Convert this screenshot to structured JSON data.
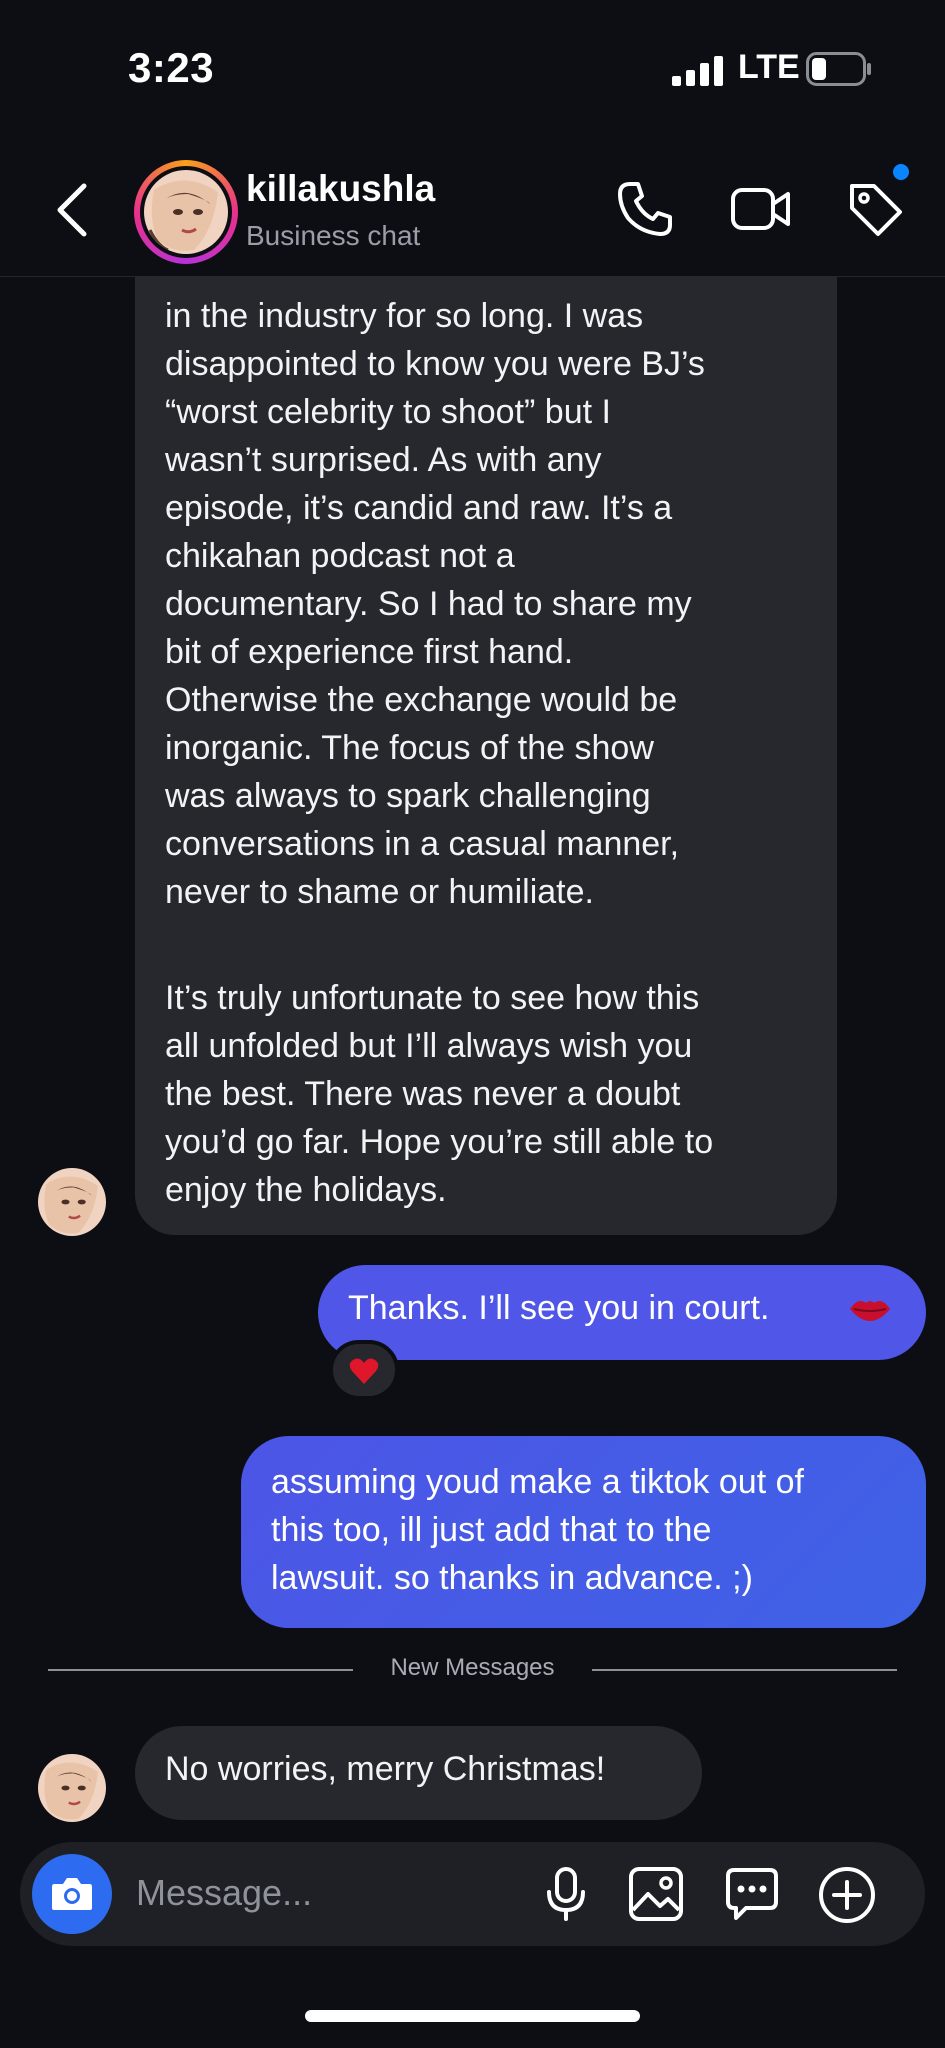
{
  "status_bar": {
    "time": "3:23",
    "network": "LTE"
  },
  "header": {
    "name": "killakushla",
    "subtitle": "Business chat"
  },
  "thread": {
    "incoming_long": [
      "in the industry for so long. I was",
      "disappointed to know you were BJ’s",
      "“worst celebrity to shoot” but I",
      "wasn’t surprised. As with any",
      "episode, it’s candid and raw. It’s a",
      "chikahan podcast not a",
      "documentary. So I had to share my",
      "bit of experience first hand.",
      "Otherwise the exchange would be",
      "inorganic. The focus of the show",
      "was always to spark challenging",
      "conversations in a casual manner,",
      "never to shame or humiliate.",
      "It’s truly unfortunate to see how this",
      "all unfolded but I’ll always wish you",
      "the best. There was never a doubt",
      "you’d go far. Hope you’re still able to",
      "enjoy the holidays."
    ],
    "outgoing_1": "Thanks. I’ll see you in court.",
    "outgoing_1_emoji": "kiss-mark-icon",
    "reaction": "heart-icon",
    "outgoing_2": [
      "assuming youd make a tiktok out of",
      "this too, ill just add that to the",
      "lawsuit. so thanks in advance. ;)"
    ],
    "new_messages_label": "New Messages",
    "incoming_2": "No worries, merry Christmas!"
  },
  "composer": {
    "placeholder": "Message..."
  },
  "colors": {
    "background": "#0c0e13",
    "incoming_bubble": "#26282e",
    "outgoing_bubble": "#4f56e8",
    "accent_blue": "#2d6cf0",
    "notification_dot": "#0a84ff"
  }
}
